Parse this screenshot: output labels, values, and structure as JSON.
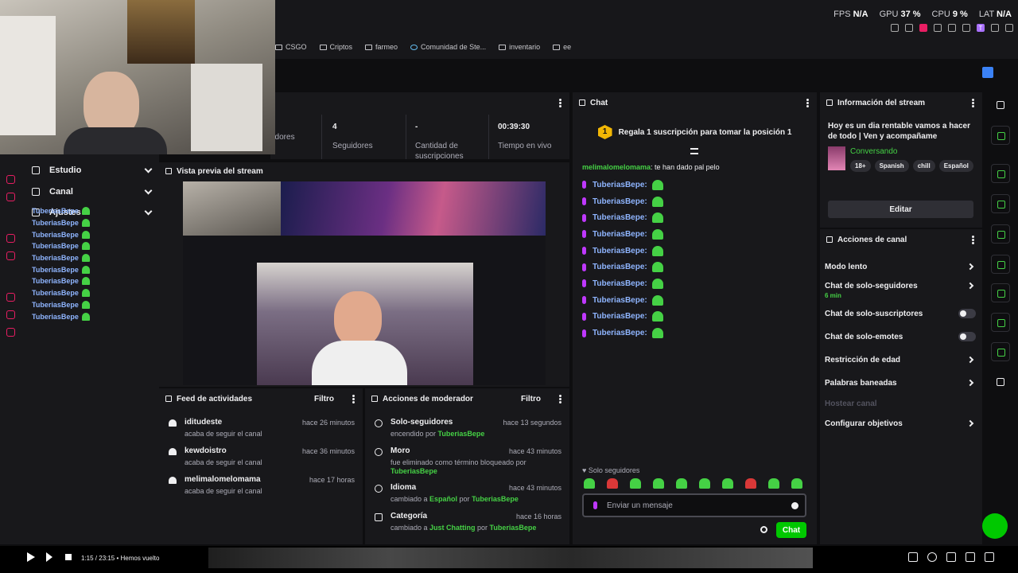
{
  "perf": {
    "fps_label": "FPS",
    "fps": "N/A",
    "gpu_label": "GPU",
    "gpu": "37 %",
    "cpu_label": "CPU",
    "cpu": "9 %",
    "lat_label": "LAT",
    "lat": "N/A"
  },
  "bookmarks": [
    "CSGO",
    "Criptos",
    "farmeo",
    "Comunidad de Ste...",
    "inventario",
    "ee"
  ],
  "stats": [
    {
      "value": "",
      "label": "adores"
    },
    {
      "value": "4",
      "label": "Seguidores"
    },
    {
      "value": "-",
      "label": "Cantidad de suscripciones"
    },
    {
      "value": "00:39:30",
      "label": "Tiempo en vivo"
    }
  ],
  "nav": {
    "items": [
      {
        "label": "Estudio"
      },
      {
        "label": "Canal"
      },
      {
        "label": "Ajustes"
      }
    ],
    "chat_users": [
      "TuberiasBepe",
      "TuberiasBepe",
      "TuberiasBepe",
      "TuberiasBepe",
      "TuberiasBepe",
      "TuberiasBepe",
      "TuberiasBepe",
      "TuberiasBepe",
      "TuberiasBepe",
      "TuberiasBepe"
    ]
  },
  "preview": {
    "title": "Vista previa del stream"
  },
  "feed": {
    "title": "Feed de actividades",
    "filter_label": "Filtro",
    "items": [
      {
        "name": "iditudeste",
        "time": "hace 26 minutos",
        "desc": "acaba de seguir el canal"
      },
      {
        "name": "kewdoistro",
        "time": "hace 36 minutos",
        "desc": "acaba de seguir el canal"
      },
      {
        "name": "melimalomelomama",
        "time": "hace 17 horas",
        "desc": "acaba de seguir el canal"
      }
    ]
  },
  "mod": {
    "title": "Acciones de moderador",
    "filter_label": "Filtro",
    "items": [
      {
        "name": "Solo-seguidores",
        "time": "hace 13 segundos",
        "desc_a": "encendido por ",
        "desc_b": "TuberiasBepe",
        "desc_c": "",
        "desc_d": ""
      },
      {
        "name": "Moro",
        "time": "hace 43 minutos",
        "desc_a": "fue eliminado como término bloqueado por ",
        "desc_b": "TuberiasBepe",
        "desc_c": "",
        "desc_d": ""
      },
      {
        "name": "Idioma",
        "time": "hace 43 minutos",
        "desc_a": "cambiado a ",
        "desc_b": "Español",
        "desc_c": " por ",
        "desc_d": "TuberiasBepe"
      },
      {
        "name": "Categoría",
        "time": "hace 16 horas",
        "desc_a": "cambiado a ",
        "desc_b": "Just Chatting",
        "desc_c": " por ",
        "desc_d": "TuberiasBepe"
      }
    ]
  },
  "chat": {
    "title": "Chat",
    "sub_rank": "1",
    "sub_banner": "Regala 1 suscripción para tomar la posición 1",
    "first_user": "melimalomelomama",
    "first_text": ": te han dado pal pelo",
    "messages": [
      "TuberiasBepe:",
      "TuberiasBepe:",
      "TuberiasBepe:",
      "TuberiasBepe:",
      "TuberiasBepe:",
      "TuberiasBepe:",
      "TuberiasBepe:",
      "TuberiasBepe:",
      "TuberiasBepe:",
      "TuberiasBepe:"
    ],
    "mode_label": "Solo seguidores",
    "input_placeholder": "Enviar un mensaje",
    "send_label": "Chat"
  },
  "info": {
    "title": "Información del stream",
    "stream_title": "Hoy es un dia rentable vamos a hacer de todo | Ven y acompañame",
    "category": "Conversando",
    "tags": [
      "18+",
      "Spanish",
      "chill",
      "Español"
    ],
    "edit_label": "Editar"
  },
  "actions": {
    "title": "Acciones de canal",
    "items": [
      {
        "label": "Modo lento",
        "sub": ""
      },
      {
        "label": "Chat de solo-seguidores",
        "sub": "6 min"
      },
      {
        "label": "Chat de solo-suscriptores",
        "sub": ""
      },
      {
        "label": "Chat de solo-emotes",
        "sub": ""
      },
      {
        "label": "Restricción de edad",
        "sub": ""
      },
      {
        "label": "Palabras baneadas",
        "sub": ""
      },
      {
        "label": "Hostear canal",
        "sub": ""
      },
      {
        "label": "Configurar objetivos",
        "sub": ""
      }
    ]
  },
  "player": {
    "time": "1:15 / 23:15 • Hemos vuelto"
  }
}
